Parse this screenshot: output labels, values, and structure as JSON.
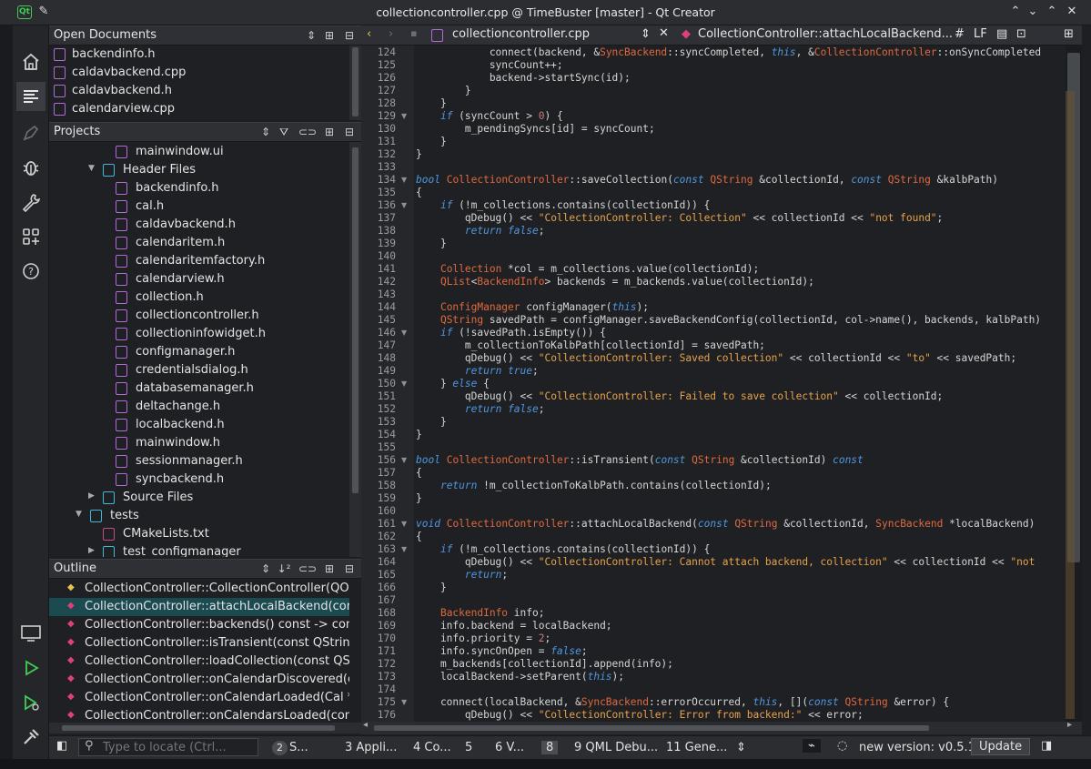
{
  "window": {
    "title": "collectioncontroller.cpp @ TimeBuster [master] - Qt Creator"
  },
  "open_documents": {
    "title": "Open Documents",
    "items": [
      "backendinfo.h",
      "caldavbackend.cpp",
      "caldavbackend.h",
      "calendarview.cpp"
    ]
  },
  "projects": {
    "title": "Projects",
    "items": [
      {
        "label": "mainwindow.ui",
        "depth": 3,
        "kind": "ui"
      },
      {
        "label": "Header Files",
        "depth": 2,
        "kind": "folder",
        "expanded": true
      },
      {
        "label": "backendinfo.h",
        "depth": 3,
        "kind": "h"
      },
      {
        "label": "cal.h",
        "depth": 3,
        "kind": "h"
      },
      {
        "label": "caldavbackend.h",
        "depth": 3,
        "kind": "h"
      },
      {
        "label": "calendaritem.h",
        "depth": 3,
        "kind": "h"
      },
      {
        "label": "calendaritemfactory.h",
        "depth": 3,
        "kind": "h"
      },
      {
        "label": "calendarview.h",
        "depth": 3,
        "kind": "h"
      },
      {
        "label": "collection.h",
        "depth": 3,
        "kind": "h"
      },
      {
        "label": "collectioncontroller.h",
        "depth": 3,
        "kind": "h"
      },
      {
        "label": "collectioninfowidget.h",
        "depth": 3,
        "kind": "h"
      },
      {
        "label": "configmanager.h",
        "depth": 3,
        "kind": "h"
      },
      {
        "label": "credentialsdialog.h",
        "depth": 3,
        "kind": "h"
      },
      {
        "label": "databasemanager.h",
        "depth": 3,
        "kind": "h"
      },
      {
        "label": "deltachange.h",
        "depth": 3,
        "kind": "h"
      },
      {
        "label": "localbackend.h",
        "depth": 3,
        "kind": "h"
      },
      {
        "label": "mainwindow.h",
        "depth": 3,
        "kind": "h"
      },
      {
        "label": "sessionmanager.h",
        "depth": 3,
        "kind": "h"
      },
      {
        "label": "syncbackend.h",
        "depth": 3,
        "kind": "h"
      },
      {
        "label": "Source Files",
        "depth": 2,
        "kind": "folder",
        "expanded": false
      },
      {
        "label": "tests",
        "depth": 1,
        "kind": "project",
        "expanded": true
      },
      {
        "label": "CMakeLists.txt",
        "depth": 2,
        "kind": "cmake"
      },
      {
        "label": "test_configmanager",
        "depth": 2,
        "kind": "project",
        "expanded": false
      }
    ]
  },
  "outline": {
    "title": "Outline",
    "items": [
      "CollectionController::CollectionController(QObje",
      "CollectionController::attachLocalBackend(const",
      "CollectionController::backends() const -> const (",
      "CollectionController::isTransient(const QString &",
      "CollectionController::loadCollection(const QStrin",
      "CollectionController::onCalendarDiscovered(con",
      "CollectionController::onCalendarLoaded(Cal *) -",
      "CollectionController::onCalendarsLoaded(const"
    ],
    "selected_index": 1
  },
  "editor": {
    "file": "collectioncontroller.cpp",
    "symbol": "CollectionController::attachLocalBackend...",
    "hash_label": "#",
    "line_ending": "LF",
    "first_line": 124,
    "lines": [
      "            connect(backend, &SyncBackend::syncCompleted, this, &CollectionController::onSyncCompleted",
      "            syncCount++;",
      "            backend->startSync(id);",
      "        }",
      "    }",
      "    if (syncCount > 0) {",
      "        m_pendingSyncs[id] = syncCount;",
      "    }",
      "}",
      "",
      "bool CollectionController::saveCollection(const QString &collectionId, const QString &kalbPath)",
      "{",
      "    if (!m_collections.contains(collectionId)) {",
      "        qDebug() << \"CollectionController: Collection\" << collectionId << \"not found\";",
      "        return false;",
      "    }",
      "",
      "    Collection *col = m_collections.value(collectionId);",
      "    QList<BackendInfo> backends = m_backends.value(collectionId);",
      "",
      "    ConfigManager configManager(this);",
      "    QString savedPath = configManager.saveBackendConfig(collectionId, col->name(), backends, kalbPath)",
      "    if (!savedPath.isEmpty()) {",
      "        m_collectionToKalbPath[collectionId] = savedPath;",
      "        qDebug() << \"CollectionController: Saved collection\" << collectionId << \"to\" << savedPath;",
      "        return true;",
      "    } else {",
      "        qDebug() << \"CollectionController: Failed to save collection\" << collectionId;",
      "        return false;",
      "    }",
      "}",
      "",
      "bool CollectionController::isTransient(const QString &collectionId) const",
      "{",
      "    return !m_collectionToKalbPath.contains(collectionId);",
      "}",
      "",
      "void CollectionController::attachLocalBackend(const QString &collectionId, SyncBackend *localBackend)",
      "{",
      "    if (!m_collections.contains(collectionId)) {",
      "        qDebug() << \"CollectionController: Cannot attach backend, collection\" << collectionId << \"not",
      "        return;",
      "    }",
      "",
      "    BackendInfo info;",
      "    info.backend = localBackend;",
      "    info.priority = 2;",
      "    info.syncOnOpen = false;",
      "    m_backends[collectionId].append(info);",
      "    localBackend->setParent(this);",
      "",
      "    connect(localBackend, &SyncBackend::errorOccurred, this, [](const QString &error) {",
      "        qDebug() << \"CollectionController: Error from backend:\" << error;"
    ],
    "fold_lines": [
      129,
      134,
      136,
      146,
      150,
      156,
      161,
      163,
      175
    ]
  },
  "statusbar": {
    "locate_placeholder": "Type to locate (Ctrl...",
    "badge_count": "2",
    "tabs": [
      "S...",
      "3  Appli...",
      "4  Co...",
      "5",
      "6  V...",
      "8",
      "9  QML Debu...",
      "11  Gene..."
    ],
    "new_version": "new version: v0.5.1",
    "update_label": "Update"
  }
}
